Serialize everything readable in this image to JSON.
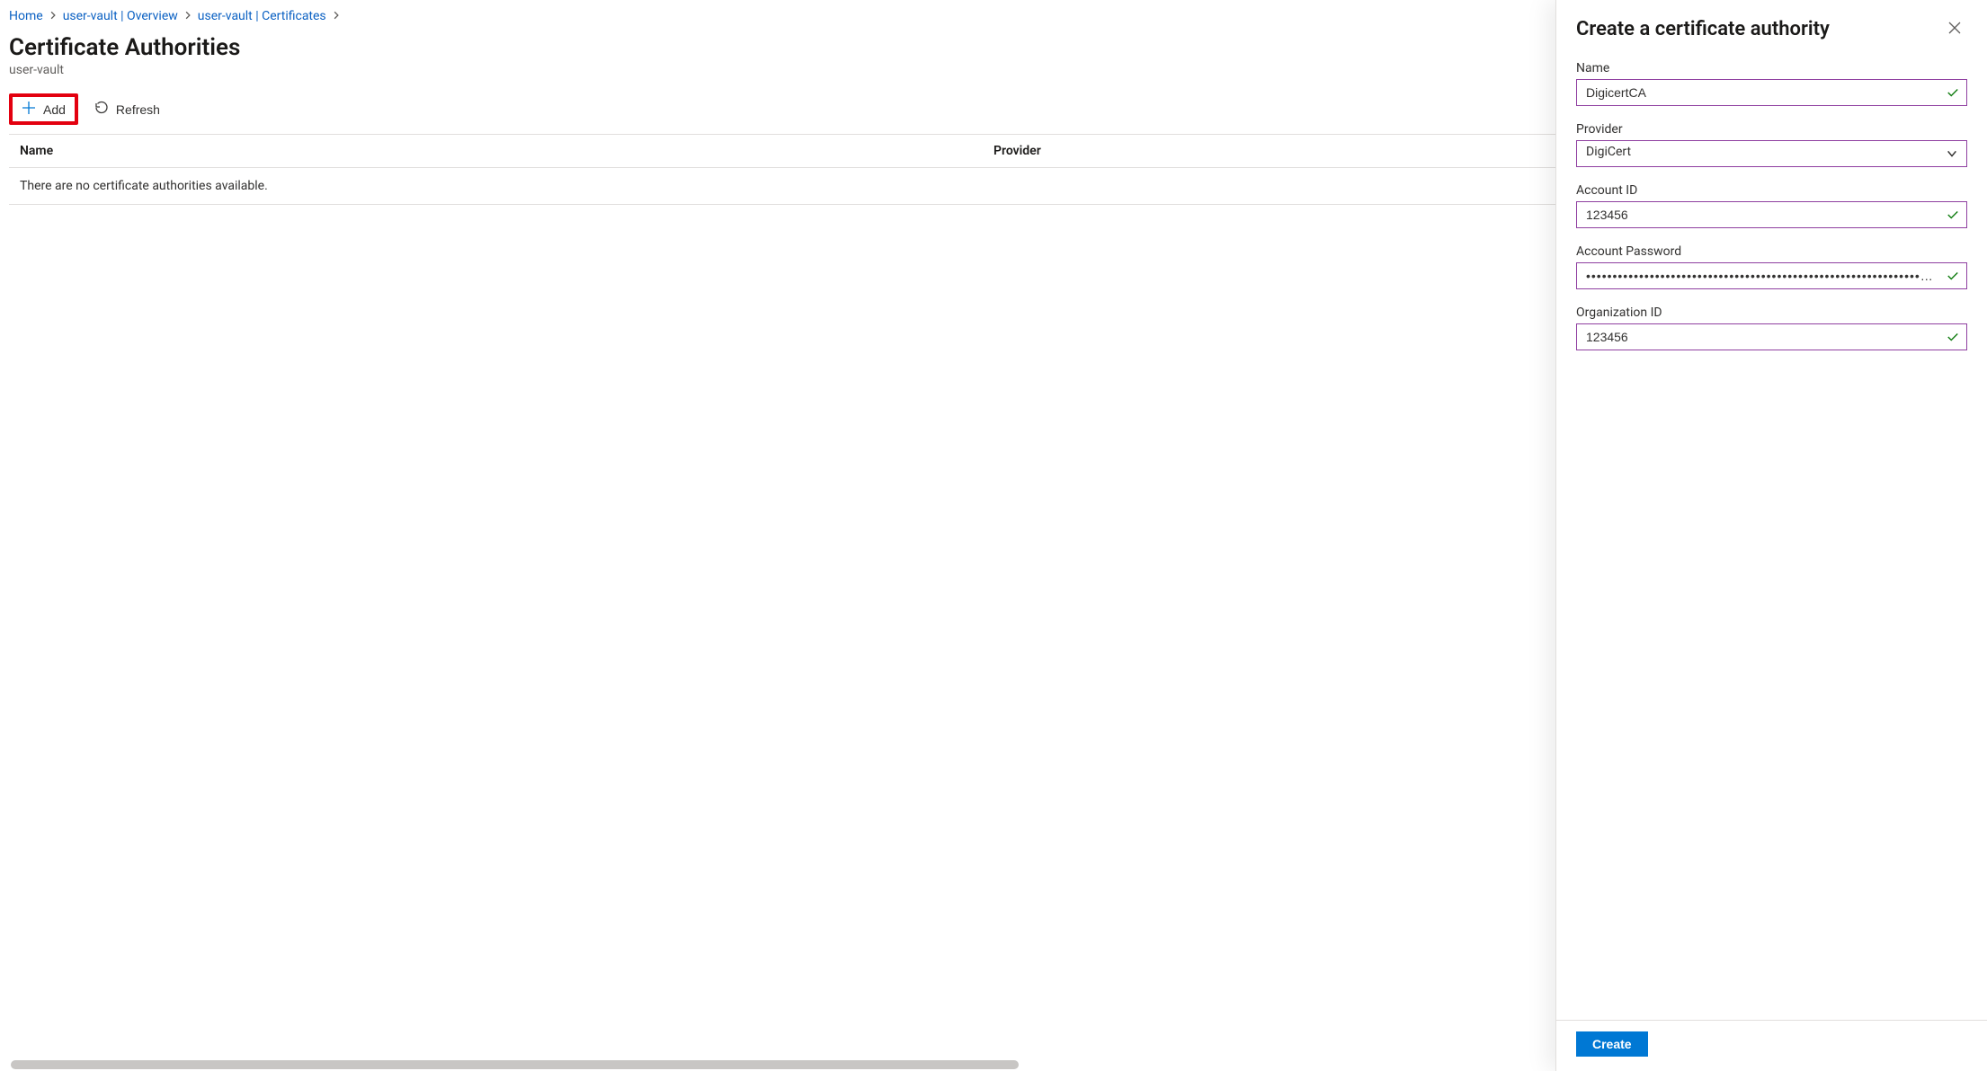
{
  "breadcrumb": {
    "items": [
      {
        "label": "Home"
      },
      {
        "label": "user-vault | Overview"
      },
      {
        "label": "user-vault | Certificates"
      }
    ]
  },
  "page": {
    "title": "Certificate Authorities",
    "subtitle": "user-vault"
  },
  "toolbar": {
    "add_label": "Add",
    "refresh_label": "Refresh"
  },
  "table": {
    "columns": {
      "name": "Name",
      "provider": "Provider"
    },
    "empty_message": "There are no certificate authorities available."
  },
  "panel": {
    "title": "Create a certificate authority",
    "labels": {
      "name": "Name",
      "provider": "Provider",
      "account_id": "Account ID",
      "account_password": "Account Password",
      "organization_id": "Organization ID"
    },
    "values": {
      "name": "DigicertCA",
      "provider_selected": "DigiCert",
      "account_id": "123456",
      "account_password_masked": "••••••••••••••••••••••••••••••••••••••••••••••••••••••••••••••••••••••••••••••••••••••••••••••••••••••...",
      "organization_id": "123456"
    },
    "footer": {
      "create_label": "Create"
    }
  }
}
